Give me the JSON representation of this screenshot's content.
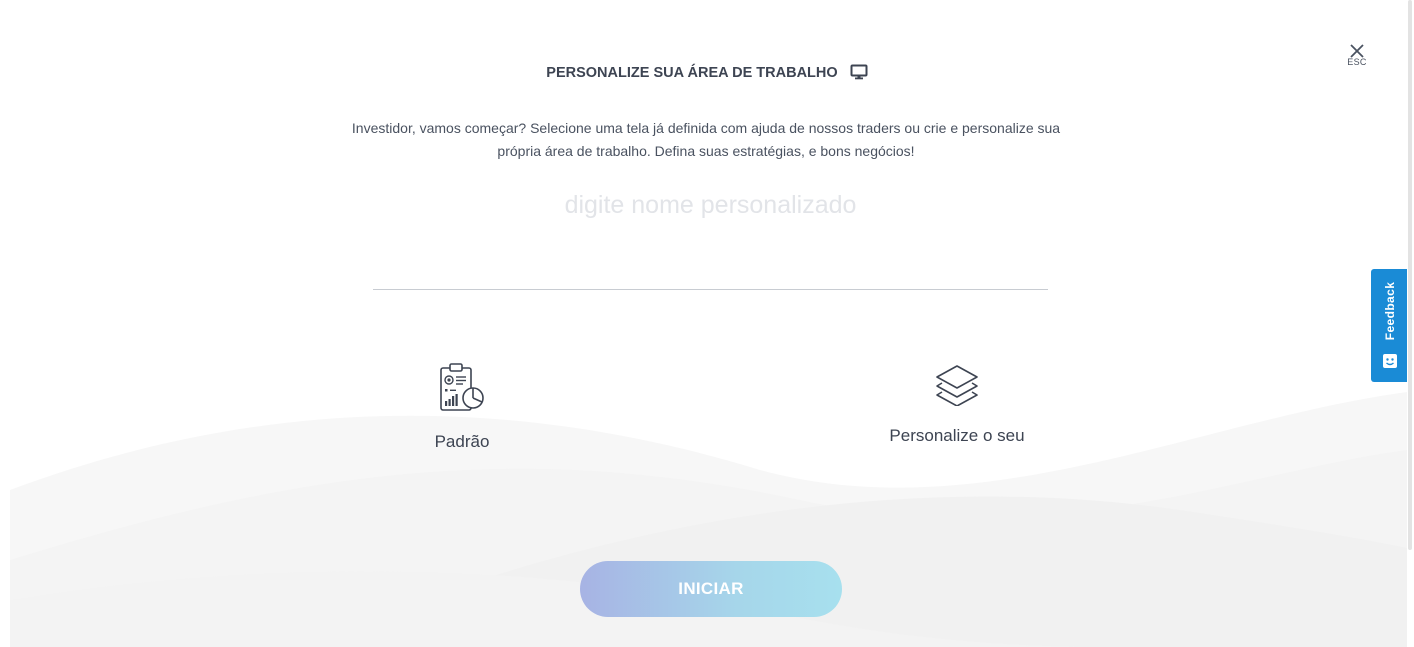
{
  "dialog": {
    "title": "PERSONALIZE SUA ÁREA DE TRABALHO",
    "title_icon": "monitor-icon",
    "intro": "Investidor, vamos começar? Selecione uma tela já definida com ajuda de nossos traders ou crie e personalize sua própria área de trabalho. Defina suas estratégias, e bons negócios!",
    "close": {
      "icon": "close-icon",
      "label": "ESC"
    },
    "name_input": {
      "placeholder": "digite nome personalizado",
      "value": ""
    },
    "options": [
      {
        "label": "Padrão",
        "icon": "report-chart-icon"
      },
      {
        "label": "Personalize o seu",
        "icon": "layers-icon"
      }
    ],
    "start_button": "INICIAR"
  },
  "feedback": {
    "label": "Feedback",
    "icon": "feedback-smile-icon",
    "color": "#1a8bd6"
  },
  "colors": {
    "text": "#3d4452",
    "placeholder": "#e2e4e8",
    "button_gradient_start": "#a7b3e4",
    "button_gradient_end": "#a7e0ee"
  }
}
